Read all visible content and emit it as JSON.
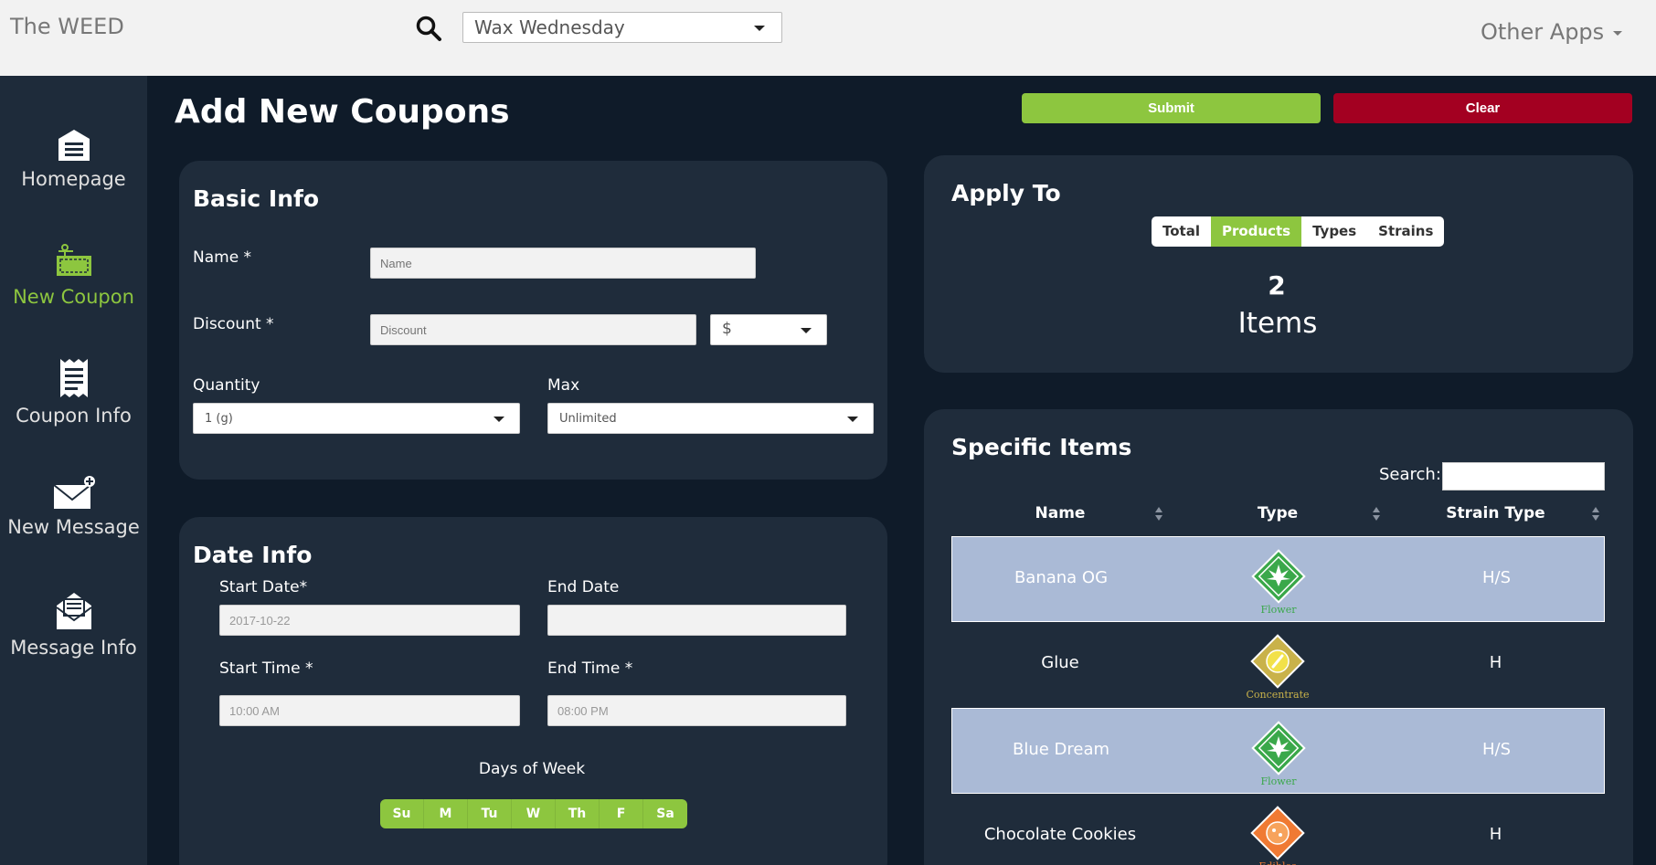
{
  "topbar": {
    "brand": "The WEED",
    "store_select": "Wax Wednesday",
    "other_apps": "Other Apps"
  },
  "sidebar": {
    "items": [
      {
        "label": "Homepage",
        "icon": "warehouse-icon"
      },
      {
        "label": "New Coupon",
        "icon": "coupon-icon",
        "active": true
      },
      {
        "label": "Coupon Info",
        "icon": "receipt-icon"
      },
      {
        "label": "New Message",
        "icon": "envelope-plus-icon"
      },
      {
        "label": "Message Info",
        "icon": "open-envelope-icon"
      }
    ]
  },
  "page": {
    "title": "Add New Coupons",
    "submit": "Submit",
    "clear": "Clear"
  },
  "basic_info": {
    "title": "Basic Info",
    "name_label": "Name *",
    "name_placeholder": "Name",
    "discount_label": "Discount *",
    "discount_placeholder": "Discount",
    "discount_unit": "$",
    "quantity_label": "Quantity",
    "quantity_value": "1 (g)",
    "max_label": "Max",
    "max_value": "Unlimited"
  },
  "date_info": {
    "title": "Date Info",
    "start_date_label": "Start Date*",
    "start_date_value": "2017-10-22",
    "end_date_label": "End Date",
    "end_date_value": "",
    "start_time_label": "Start Time *",
    "start_time_value": "10:00 AM",
    "end_time_label": "End Time *",
    "end_time_value": "08:00 PM",
    "days_label": "Days of Week",
    "days": [
      "Su",
      "M",
      "Tu",
      "W",
      "Th",
      "F",
      "Sa"
    ]
  },
  "apply_to": {
    "title": "Apply To",
    "options": [
      "Total",
      "Products",
      "Types",
      "Strains"
    ],
    "selected": "Products",
    "count": "2",
    "count_label": "Items"
  },
  "specific_items": {
    "title": "Specific Items",
    "search_label": "Search:",
    "columns": [
      "Name",
      "Type",
      "Strain Type"
    ],
    "rows": [
      {
        "name": "Banana OG",
        "type": "Flower",
        "strain": "H/S",
        "selected": true
      },
      {
        "name": "Glue",
        "type": "Concentrate",
        "strain": "H",
        "selected": false
      },
      {
        "name": "Blue Dream",
        "type": "Flower",
        "strain": "H/S",
        "selected": true
      },
      {
        "name": "Chocolate Cookies",
        "type": "Edibles",
        "strain": "H",
        "selected": false
      }
    ]
  },
  "colors": {
    "accent_green": "#8dc63f",
    "danger_red": "#a30021",
    "panel": "#1f2c3b",
    "background": "#0f1b29",
    "row_highlight": "#aabad6",
    "flower": "#3aa84a",
    "concentrate": "#c9b24a",
    "edibles": "#f07a33"
  }
}
